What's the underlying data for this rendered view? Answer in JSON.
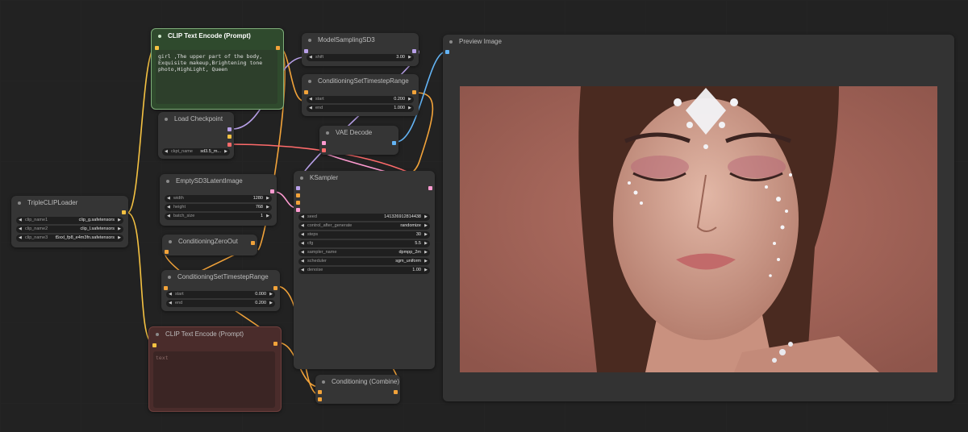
{
  "colors": {
    "canvas": "#222222",
    "node": "#353535",
    "positive_prompt": "#2f4a2d",
    "negative_prompt": "#4a2c2b",
    "wire_clip": "#f5c242",
    "wire_cond": "#f2a33a",
    "wire_model": "#b8a0e8",
    "wire_latent": "#ff9bd1",
    "wire_vae": "#ff6b6b",
    "wire_image": "#64b5f6"
  },
  "nodes": {
    "clip_pos": {
      "title": "CLIP Text Encode (Prompt)",
      "text": "girl ,The upper part of the body,\nExquisite makeup,Brightening tone\nphoto,HighLight, Queen"
    },
    "clip_neg": {
      "title": "CLIP Text Encode (Prompt)",
      "placeholder": "text"
    },
    "model_sampling": {
      "title": "ModelSamplingSD3",
      "shift_label": "shift",
      "shift_value": "3.00"
    },
    "cond_range_top": {
      "title": "ConditioningSetTimestepRange",
      "start_label": "start",
      "start_value": "0.200",
      "end_label": "end",
      "end_value": "1.000"
    },
    "load_checkpoint": {
      "title": "Load Checkpoint",
      "ckpt_label": "ckpt_name",
      "ckpt_value": "sd3.5_m..."
    },
    "vae_decode": {
      "title": "VAE Decode"
    },
    "empty_latent": {
      "title": "EmptySD3LatentImage",
      "width_label": "width",
      "width_value": "1280",
      "height_label": "height",
      "height_value": "768",
      "batch_label": "batch_size",
      "batch_value": "1"
    },
    "triple_clip": {
      "title": "TripleCLIPLoader",
      "clip1_label": "clip_name1",
      "clip1_value": "clip_g.safetensors",
      "clip2_label": "clip_name2",
      "clip2_value": "clip_l.safetensors",
      "clip3_label": "clip_name3",
      "clip3_value": "t5xxl_fp8_e4m3fn.safetensors"
    },
    "cond_zero": {
      "title": "ConditioningZeroOut"
    },
    "cond_range_bottom": {
      "title": "ConditioningSetTimestepRange",
      "start_label": "start",
      "start_value": "0.000",
      "end_label": "end",
      "end_value": "0.200"
    },
    "ksampler": {
      "title": "KSampler",
      "widgets": [
        {
          "label": "seed",
          "value": "141326912814438"
        },
        {
          "label": "control_after_generate",
          "value": "randomize"
        },
        {
          "label": "steps",
          "value": "30"
        },
        {
          "label": "cfg",
          "value": "5.5"
        },
        {
          "label": "sampler_name",
          "value": "dpmpp_2m"
        },
        {
          "label": "scheduler",
          "value": "sgm_uniform"
        },
        {
          "label": "denoise",
          "value": "1.00"
        }
      ]
    },
    "cond_combine": {
      "title": "Conditioning (Combine)"
    },
    "preview": {
      "title": "Preview Image"
    }
  }
}
